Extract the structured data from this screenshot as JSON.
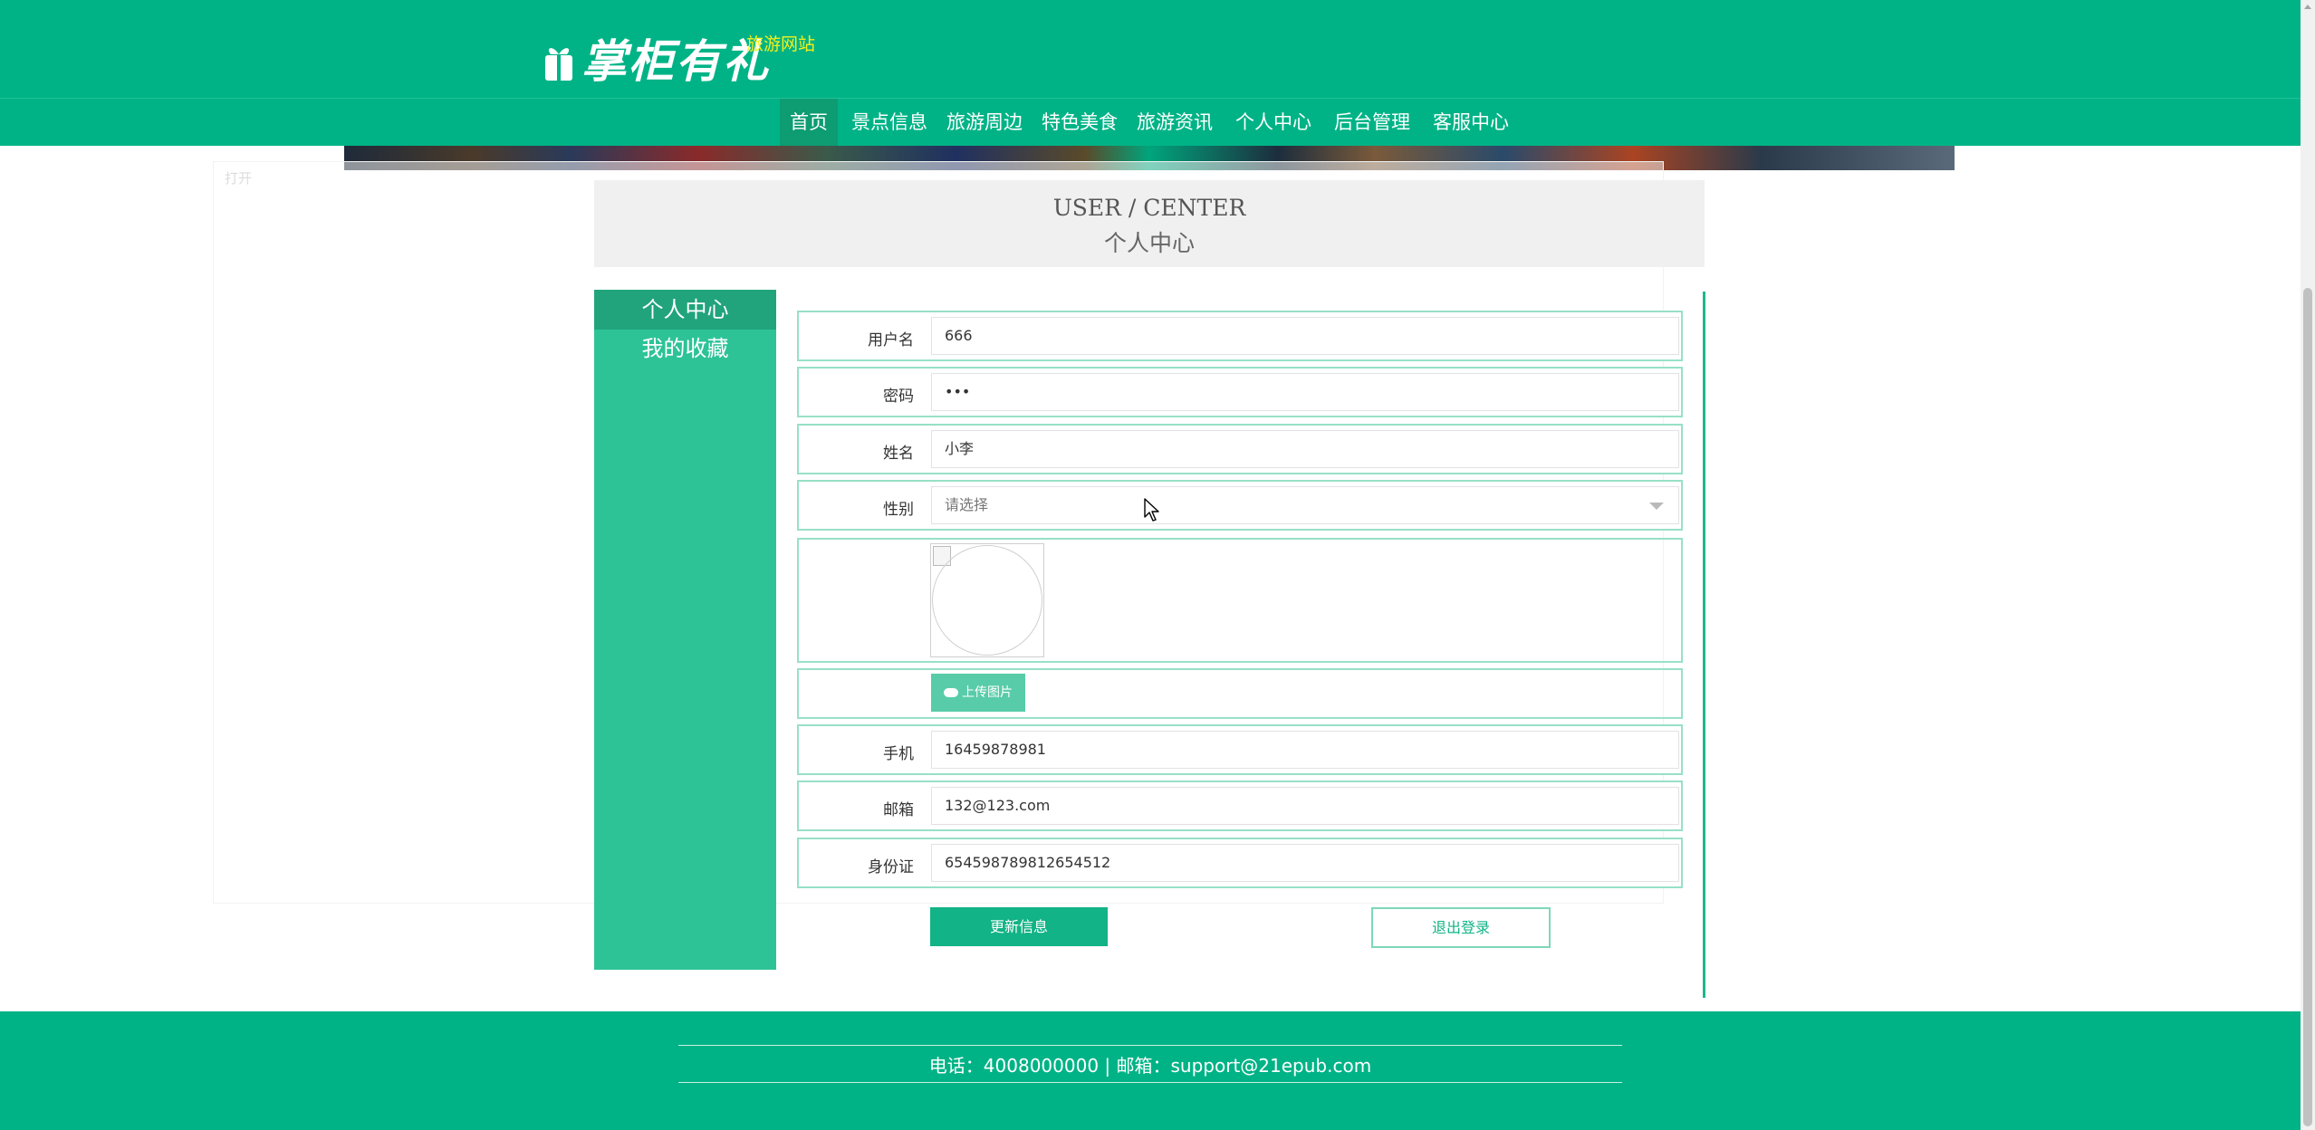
{
  "header": {
    "logo_text": "掌柜有礼",
    "site_subtitle": "旅游网站"
  },
  "nav": {
    "items": [
      {
        "label": "首页",
        "active": true
      },
      {
        "label": "景点信息"
      },
      {
        "label": "旅游周边"
      },
      {
        "label": "特色美食"
      },
      {
        "label": "旅游资讯"
      },
      {
        "label": "个人中心"
      },
      {
        "label": "后台管理"
      },
      {
        "label": "客服中心"
      }
    ]
  },
  "overlay": {
    "label": "打开"
  },
  "page_title": {
    "en": "USER / CENTER",
    "cn": "个人中心"
  },
  "sidebar": {
    "items": [
      {
        "label": "个人中心",
        "active": true
      },
      {
        "label": "我的收藏"
      }
    ]
  },
  "form": {
    "username": {
      "label": "用户名",
      "value": "666"
    },
    "password": {
      "label": "密码",
      "value": "•••"
    },
    "name": {
      "label": "姓名",
      "value": "小李"
    },
    "gender": {
      "label": "性别",
      "placeholder": "请选择"
    },
    "upload_label": "上传图片",
    "phone": {
      "label": "手机",
      "value": "16459878981"
    },
    "email": {
      "label": "邮箱",
      "value": "132@123.com"
    },
    "idcard": {
      "label": "身份证",
      "value": "654598789812654512"
    },
    "update_button": "更新信息",
    "logout_button": "退出登录"
  },
  "footer": {
    "contact": "电话：4008000000 | 邮箱：support@21epub.com"
  },
  "colors": {
    "brand": "#00b386",
    "sidebar": "#2dc397",
    "sidebar_active": "#21a47c",
    "subtitle": "#f5f01a"
  },
  "icons": [
    "gift-icon",
    "chevron-down-icon",
    "cloud-upload-icon",
    "mouse-cursor-icon"
  ]
}
